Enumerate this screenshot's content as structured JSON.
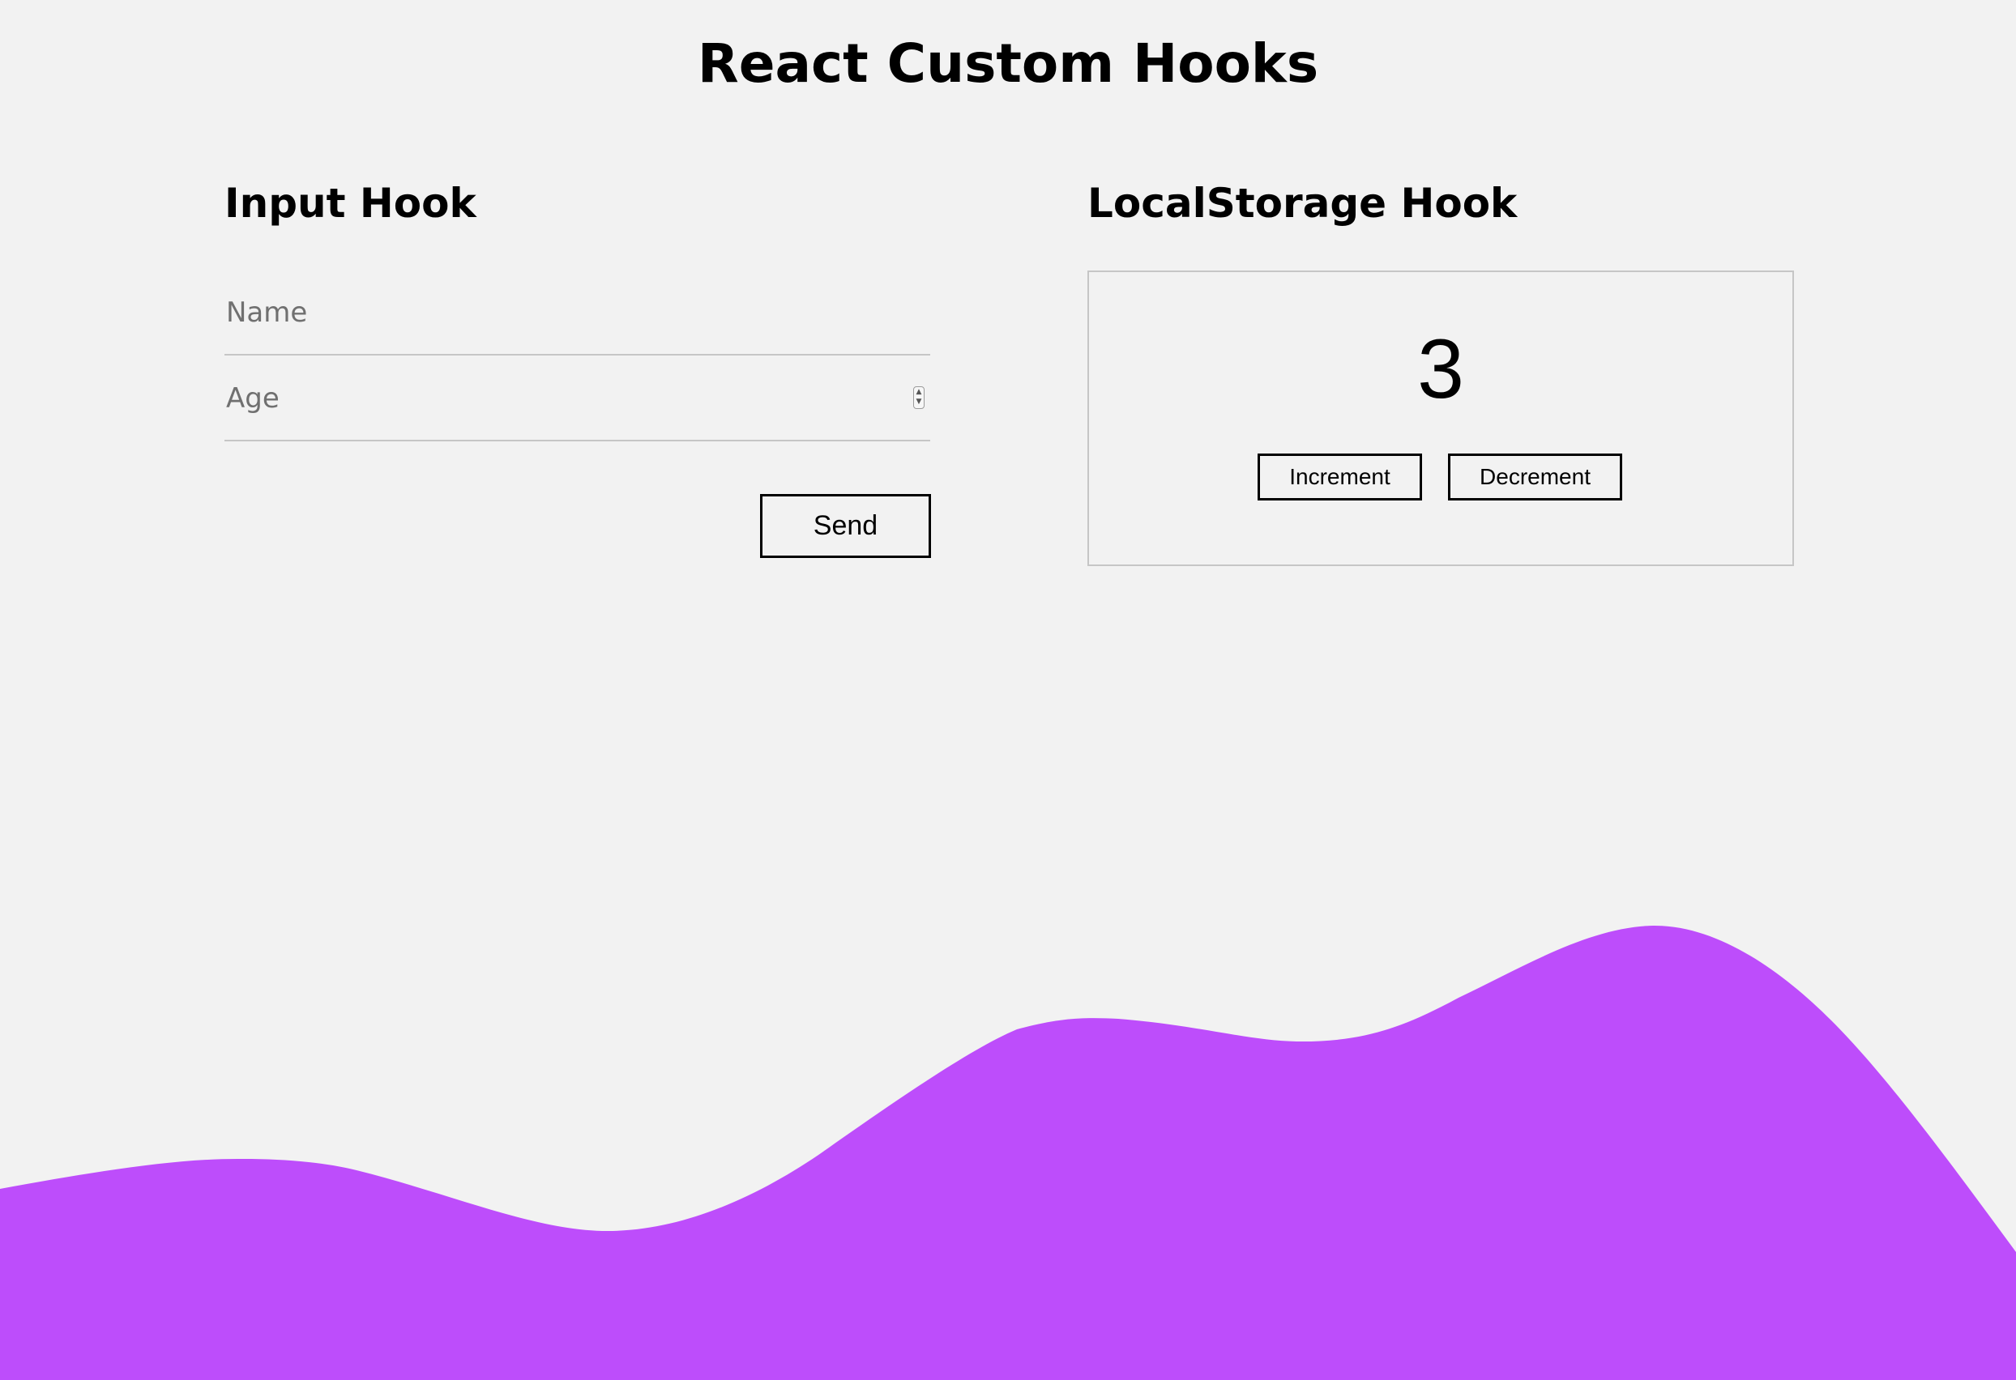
{
  "header": {
    "title": "React Custom Hooks"
  },
  "input_hook": {
    "heading": "Input Hook",
    "name_placeholder": "Name",
    "age_placeholder": "Age",
    "send_label": "Send"
  },
  "storage_hook": {
    "heading": "LocalStorage Hook",
    "counter_value": "3",
    "increment_label": "Increment",
    "decrement_label": "Decrement"
  },
  "colors": {
    "background": "#f2f2f2",
    "wave": "#bd4dfb",
    "input_border": "#c6c6c6"
  },
  "icons": {
    "spinner": "number-spinner-icon"
  }
}
